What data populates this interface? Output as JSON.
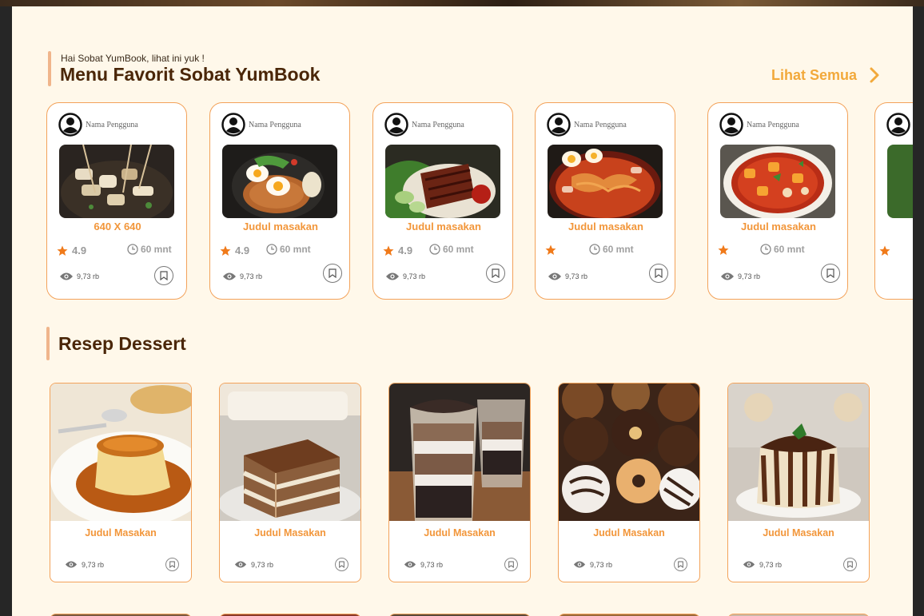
{
  "favorit": {
    "greeting": "Hai Sobat YumBook, lihat ini yuk !",
    "title": "Menu Favorit Sobat YumBook",
    "see_all": "Lihat Semua",
    "cards": [
      {
        "user": "Nama Pengguna",
        "title": "640 X 640",
        "rating": "4.9",
        "time": "60 mnt",
        "views": "9,73 rb",
        "image": "oden-skewers"
      },
      {
        "user": "Nama Pengguna",
        "title": "Judul masakan",
        "rating": "4.9",
        "time": "60 mnt",
        "views": "9,73 rb",
        "image": "mie-goreng-telur"
      },
      {
        "user": "Nama Pengguna",
        "title": "Judul masakan",
        "rating": "4.9",
        "time": "60 mnt",
        "views": "9,73 rb",
        "image": "grilled-meat-plate"
      },
      {
        "user": "Nama Pengguna",
        "title": "Judul masakan",
        "rating": "",
        "time": "60 mnt",
        "views": "9,73 rb",
        "image": "spicy-noodle-pan"
      },
      {
        "user": "Nama Pengguna",
        "title": "Judul masakan",
        "rating": "",
        "time": "60 mnt",
        "views": "9,73 rb",
        "image": "seblak-bowl"
      }
    ]
  },
  "dessert": {
    "title": "Resep Dessert",
    "cards": [
      {
        "title": "Judul Masakan",
        "views": "9,73 rb",
        "image": "caramel-pudding"
      },
      {
        "title": "Judul Masakan",
        "views": "9,73 rb",
        "image": "tiramisu"
      },
      {
        "title": "Judul Masakan",
        "views": "9,73 rb",
        "image": "oreo-cup"
      },
      {
        "title": "Judul Masakan",
        "views": "9,73 rb",
        "image": "donuts"
      },
      {
        "title": "Judul Masakan",
        "views": "9,73 rb",
        "image": "chocolate-pudding"
      }
    ]
  },
  "colors": {
    "accent": "#f2963a",
    "title": "#4a2608",
    "background": "#fff8ea",
    "star": "#f07a1a"
  }
}
